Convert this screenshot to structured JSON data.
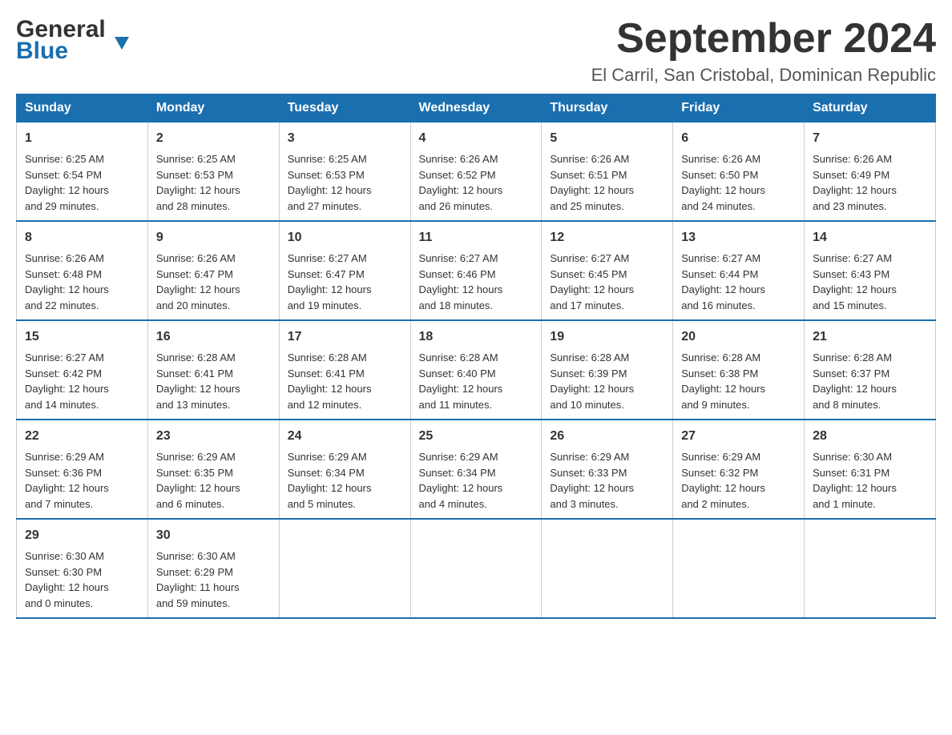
{
  "logo": {
    "general": "General",
    "blue": "Blue",
    "triangle": "▼"
  },
  "title": "September 2024",
  "location": "El Carril, San Cristobal, Dominican Republic",
  "days_of_week": [
    "Sunday",
    "Monday",
    "Tuesday",
    "Wednesday",
    "Thursday",
    "Friday",
    "Saturday"
  ],
  "weeks": [
    [
      {
        "day": "1",
        "sunrise": "6:25 AM",
        "sunset": "6:54 PM",
        "daylight": "12 hours and 29 minutes."
      },
      {
        "day": "2",
        "sunrise": "6:25 AM",
        "sunset": "6:53 PM",
        "daylight": "12 hours and 28 minutes."
      },
      {
        "day": "3",
        "sunrise": "6:25 AM",
        "sunset": "6:53 PM",
        "daylight": "12 hours and 27 minutes."
      },
      {
        "day": "4",
        "sunrise": "6:26 AM",
        "sunset": "6:52 PM",
        "daylight": "12 hours and 26 minutes."
      },
      {
        "day": "5",
        "sunrise": "6:26 AM",
        "sunset": "6:51 PM",
        "daylight": "12 hours and 25 minutes."
      },
      {
        "day": "6",
        "sunrise": "6:26 AM",
        "sunset": "6:50 PM",
        "daylight": "12 hours and 24 minutes."
      },
      {
        "day": "7",
        "sunrise": "6:26 AM",
        "sunset": "6:49 PM",
        "daylight": "12 hours and 23 minutes."
      }
    ],
    [
      {
        "day": "8",
        "sunrise": "6:26 AM",
        "sunset": "6:48 PM",
        "daylight": "12 hours and 22 minutes."
      },
      {
        "day": "9",
        "sunrise": "6:26 AM",
        "sunset": "6:47 PM",
        "daylight": "12 hours and 20 minutes."
      },
      {
        "day": "10",
        "sunrise": "6:27 AM",
        "sunset": "6:47 PM",
        "daylight": "12 hours and 19 minutes."
      },
      {
        "day": "11",
        "sunrise": "6:27 AM",
        "sunset": "6:46 PM",
        "daylight": "12 hours and 18 minutes."
      },
      {
        "day": "12",
        "sunrise": "6:27 AM",
        "sunset": "6:45 PM",
        "daylight": "12 hours and 17 minutes."
      },
      {
        "day": "13",
        "sunrise": "6:27 AM",
        "sunset": "6:44 PM",
        "daylight": "12 hours and 16 minutes."
      },
      {
        "day": "14",
        "sunrise": "6:27 AM",
        "sunset": "6:43 PM",
        "daylight": "12 hours and 15 minutes."
      }
    ],
    [
      {
        "day": "15",
        "sunrise": "6:27 AM",
        "sunset": "6:42 PM",
        "daylight": "12 hours and 14 minutes."
      },
      {
        "day": "16",
        "sunrise": "6:28 AM",
        "sunset": "6:41 PM",
        "daylight": "12 hours and 13 minutes."
      },
      {
        "day": "17",
        "sunrise": "6:28 AM",
        "sunset": "6:41 PM",
        "daylight": "12 hours and 12 minutes."
      },
      {
        "day": "18",
        "sunrise": "6:28 AM",
        "sunset": "6:40 PM",
        "daylight": "12 hours and 11 minutes."
      },
      {
        "day": "19",
        "sunrise": "6:28 AM",
        "sunset": "6:39 PM",
        "daylight": "12 hours and 10 minutes."
      },
      {
        "day": "20",
        "sunrise": "6:28 AM",
        "sunset": "6:38 PM",
        "daylight": "12 hours and 9 minutes."
      },
      {
        "day": "21",
        "sunrise": "6:28 AM",
        "sunset": "6:37 PM",
        "daylight": "12 hours and 8 minutes."
      }
    ],
    [
      {
        "day": "22",
        "sunrise": "6:29 AM",
        "sunset": "6:36 PM",
        "daylight": "12 hours and 7 minutes."
      },
      {
        "day": "23",
        "sunrise": "6:29 AM",
        "sunset": "6:35 PM",
        "daylight": "12 hours and 6 minutes."
      },
      {
        "day": "24",
        "sunrise": "6:29 AM",
        "sunset": "6:34 PM",
        "daylight": "12 hours and 5 minutes."
      },
      {
        "day": "25",
        "sunrise": "6:29 AM",
        "sunset": "6:34 PM",
        "daylight": "12 hours and 4 minutes."
      },
      {
        "day": "26",
        "sunrise": "6:29 AM",
        "sunset": "6:33 PM",
        "daylight": "12 hours and 3 minutes."
      },
      {
        "day": "27",
        "sunrise": "6:29 AM",
        "sunset": "6:32 PM",
        "daylight": "12 hours and 2 minutes."
      },
      {
        "day": "28",
        "sunrise": "6:30 AM",
        "sunset": "6:31 PM",
        "daylight": "12 hours and 1 minute."
      }
    ],
    [
      {
        "day": "29",
        "sunrise": "6:30 AM",
        "sunset": "6:30 PM",
        "daylight": "12 hours and 0 minutes."
      },
      {
        "day": "30",
        "sunrise": "6:30 AM",
        "sunset": "6:29 PM",
        "daylight": "11 hours and 59 minutes."
      },
      null,
      null,
      null,
      null,
      null
    ]
  ],
  "labels": {
    "sunrise": "Sunrise:",
    "sunset": "Sunset:",
    "daylight": "Daylight:"
  }
}
